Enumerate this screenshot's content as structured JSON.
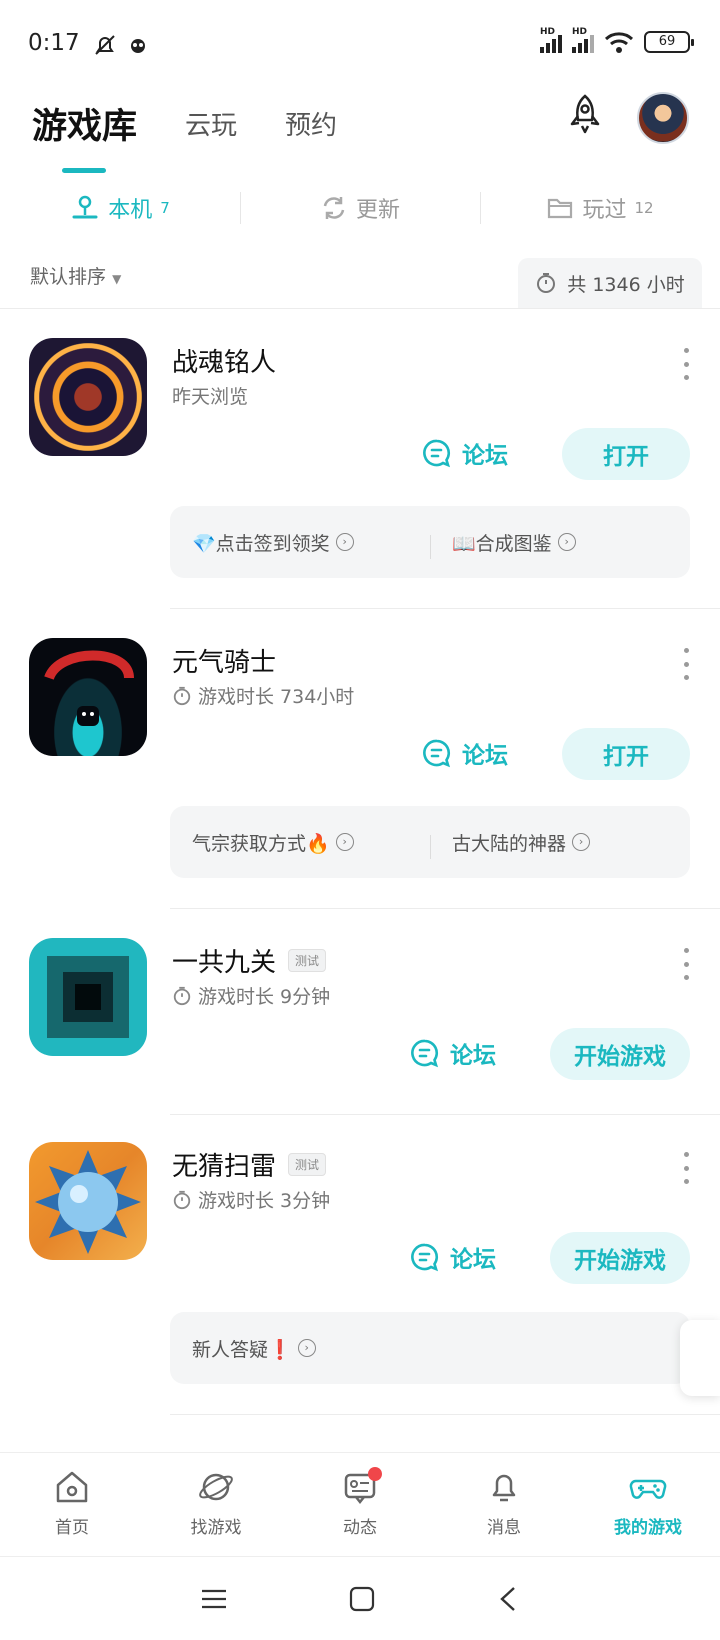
{
  "status_bar": {
    "time": "0:17",
    "battery": "69"
  },
  "top_tabs": [
    "游戏库",
    "云玩",
    "预约"
  ],
  "sub_tabs": [
    {
      "label": "本机",
      "count": "7"
    },
    {
      "label": "更新",
      "count": ""
    },
    {
      "label": "玩过",
      "count": "12"
    }
  ],
  "sort_label": "默认排序",
  "total_hours": "共 1346 小时",
  "games": [
    {
      "name": "战魂铭人",
      "subtitle": "昨天浏览",
      "forum_label": "论坛",
      "action_label": "打开",
      "links": [
        "💎点击签到领奖",
        "📖合成图鉴"
      ]
    },
    {
      "name": "元气骑士",
      "subtitle": "游戏时长 734小时",
      "forum_label": "论坛",
      "action_label": "打开",
      "links": [
        "气宗获取方式🔥",
        "古大陆的神器"
      ]
    },
    {
      "name": "一共九关",
      "badge": "测试",
      "subtitle": "游戏时长 9分钟",
      "forum_label": "论坛",
      "action_label": "开始游戏"
    },
    {
      "name": "无猜扫雷",
      "badge": "测试",
      "subtitle": "游戏时长 3分钟",
      "forum_label": "论坛",
      "action_label": "开始游戏",
      "links": [
        "新人答疑❗"
      ]
    }
  ],
  "bottom_nav": [
    "首页",
    "找游戏",
    "动态",
    "消息",
    "我的游戏"
  ],
  "colors": {
    "accent": "#1bb8c0",
    "badge_dot": "#f0464a"
  }
}
